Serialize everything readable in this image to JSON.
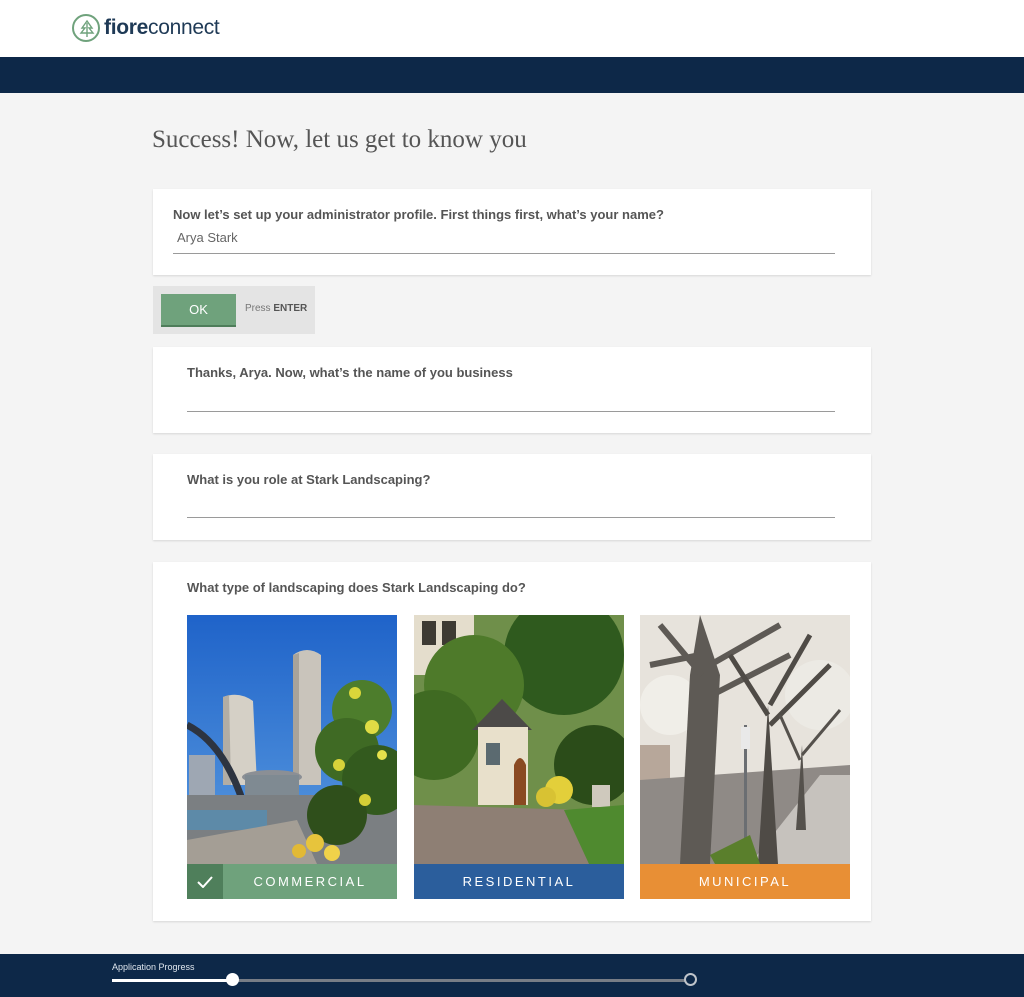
{
  "brand": {
    "name_bold": "fiore",
    "name_light": "connect"
  },
  "page": {
    "title": "Success! Now, let us get to know you"
  },
  "questions": {
    "name": {
      "label": "Now let’s set up your administrator profile. First things first, what’s your name?",
      "value": "Arya Stark"
    },
    "ok": {
      "label": "OK",
      "hint_prefix": "Press",
      "hint_key": "ENTER"
    },
    "business": {
      "label": "Thanks, Arya. Now, what’s the name of you business",
      "value": ""
    },
    "role": {
      "label": "What is you role at Stark Landscaping?",
      "value": ""
    },
    "type": {
      "label": "What type of landscaping does Stark Landscaping do?",
      "options": [
        {
          "label": "COMMERCIAL",
          "color": "#6fa27c",
          "selected": true
        },
        {
          "label": "RESIDENTIAL",
          "color": "#2b5e9c",
          "selected": false
        },
        {
          "label": "MUNICIPAL",
          "color": "#e88f35",
          "selected": false
        }
      ]
    }
  },
  "progress": {
    "label": "Application Progress",
    "fraction": 0.207
  },
  "icons": {
    "logo": "tree-logo-icon",
    "check": "check-icon",
    "end": "progress-end-icon"
  }
}
